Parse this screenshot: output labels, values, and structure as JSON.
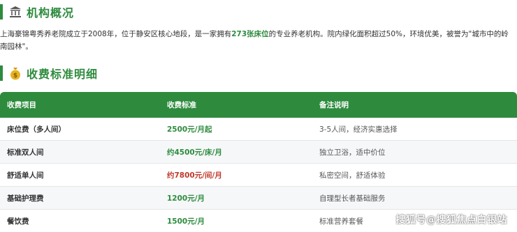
{
  "org_section": {
    "icon": "bank-icon",
    "title": "机构概况",
    "intro_before": "上海豪锦粤秀养老院成立于2008年，位于静安区核心地段，是一家拥有",
    "intro_highlight": "273张床位",
    "intro_after": "的专业养老机构。院内绿化面积超过50%，环境优美，被誉为\"城市中的岭南园林\"。"
  },
  "fee_section": {
    "icon": "money-bag-icon",
    "title": "收费标准明细"
  },
  "table": {
    "headers": [
      "收费项目",
      "收费标准",
      "备注说明"
    ],
    "rows": [
      {
        "item": "床位费（多人间）",
        "price": "2500元/月起",
        "price_color": "green",
        "note": "3-5人间，经济实惠选择"
      },
      {
        "item": "标准双人间",
        "price": "约4500元/床/月",
        "price_color": "green",
        "note": "独立卫浴，适中价位"
      },
      {
        "item": "舒适单人间",
        "price": "约7800元/间/月",
        "price_color": "red",
        "note": "私密空间，舒适体验"
      },
      {
        "item": "基础护理费",
        "price": "1200元/月",
        "price_color": "green",
        "note": "自理型长者基础服务"
      },
      {
        "item": "餐饮费",
        "price": "1500元/月",
        "price_color": "green",
        "note": "标准营养套餐"
      }
    ]
  },
  "colors": {
    "accent": "#2e8b3e",
    "price_red": "#c0392b"
  },
  "watermark": "搜狐号@搜狐焦点白银站"
}
